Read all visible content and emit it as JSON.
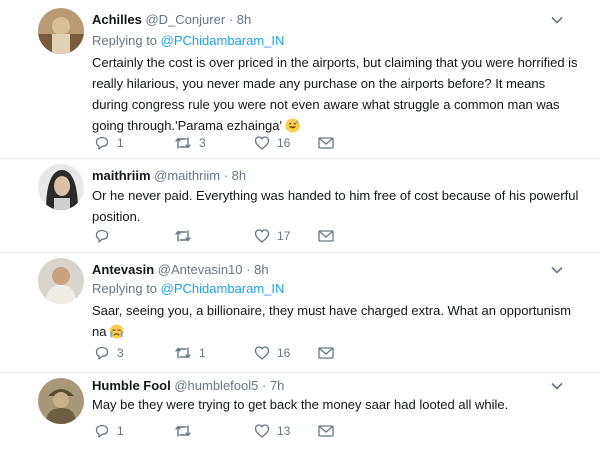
{
  "tweets": [
    {
      "name": "Achilles",
      "handle": "@D_Conjurer",
      "time": "8h",
      "replying_prefix": "Replying to",
      "replying_to": "@PChidambaram_IN",
      "text": "Certainly the cost is over priced in the airports, but claiming that you were horrified is really hilarious, you never made any purchase on the airports before? It means during congress rule you were not even aware what struggle a common man was going through.'Parama ezhainga'",
      "emoji": "grinning-sweat-emoji",
      "replies": "1",
      "retweets": "3",
      "likes": "16"
    },
    {
      "name": "maithriim",
      "handle": "@maithriim",
      "time": "8h",
      "text": "Or he never paid. Everything was handed to him free of cost because of his powerful position.",
      "replies": "",
      "retweets": "",
      "likes": "17"
    },
    {
      "name": "Antevasin",
      "handle": "@Antevasin10",
      "time": "8h",
      "replying_prefix": "Replying to",
      "replying_to": "@PChidambaram_IN",
      "text": "Saar, seeing you, a billionaire, they must have charged extra. What an opportunism na",
      "emoji": "crying-face-emoji",
      "replies": "3",
      "retweets": "1",
      "likes": "16"
    },
    {
      "name": "Humble Fool",
      "handle": "@humblefool5",
      "time": "7h",
      "text": "May be they were trying to get back the money saar had looted all while.",
      "replies": "1",
      "retweets": "",
      "likes": "13"
    }
  ],
  "icons": {
    "reply": "reply-icon",
    "retweet": "retweet-icon",
    "like": "heart-icon",
    "dm": "envelope-icon",
    "menu": "chevron-down-icon"
  },
  "colors": {
    "link": "#1da1f2",
    "muted": "#657786",
    "text": "#14171a",
    "divider": "#e6ecf0"
  }
}
